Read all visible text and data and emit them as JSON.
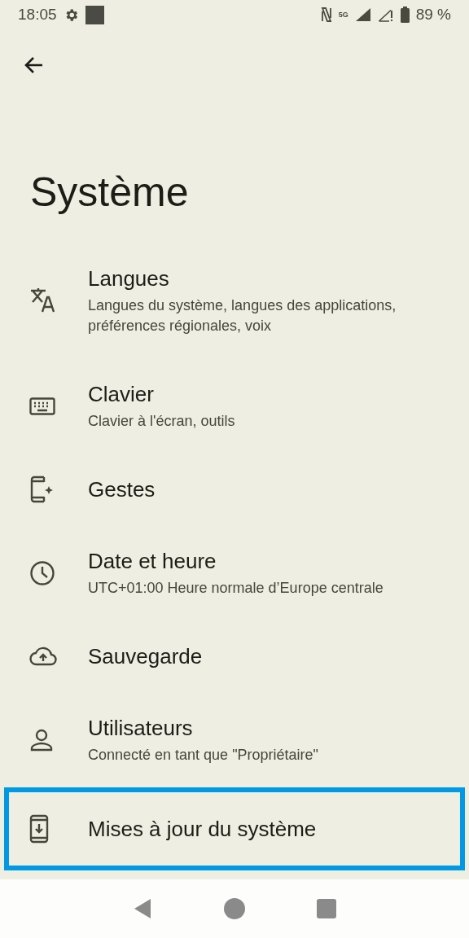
{
  "status_bar": {
    "time": "18:05",
    "network": "5G",
    "battery": "89 %"
  },
  "title": "Système",
  "items": [
    {
      "kind": "translate",
      "title": "Langues",
      "subtitle": "Langues du système, langues des applications, préférences régionales, voix",
      "highlighted": false
    },
    {
      "kind": "keyboard",
      "title": "Clavier",
      "subtitle": "Clavier à l'écran, outils",
      "highlighted": false
    },
    {
      "kind": "gestures",
      "title": "Gestes",
      "highlighted": false
    },
    {
      "kind": "clock",
      "title": "Date et heure",
      "subtitle": "UTC+01:00 Heure normale d’Europe centrale",
      "highlighted": false
    },
    {
      "kind": "backup",
      "title": "Sauvegarde",
      "highlighted": false
    },
    {
      "kind": "user",
      "title": "Utilisateurs",
      "subtitle": "Connecté en tant que \"Propriétaire\"",
      "highlighted": false
    },
    {
      "kind": "update",
      "title": "Mises à jour du système",
      "highlighted": true
    }
  ]
}
